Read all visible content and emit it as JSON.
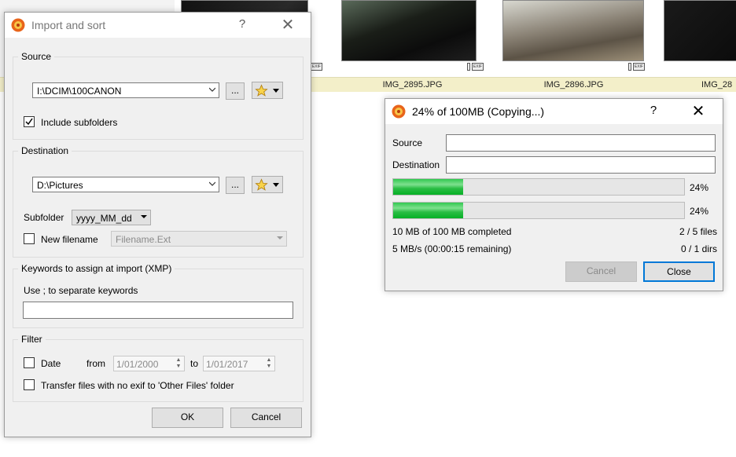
{
  "thumbnails": [
    {
      "caption": ""
    },
    {
      "caption": "IMG_2895.JPG"
    },
    {
      "caption": "IMG_2896.JPG"
    },
    {
      "caption": "IMG_28"
    }
  ],
  "exif_badge": "EXIF",
  "import_dialog": {
    "title": "Import and sort",
    "help": "?",
    "close": "✕",
    "source": {
      "label": "Source",
      "path": "I:\\DCIM\\100CANON",
      "browse": "...",
      "include_subfolders": "Include subfolders",
      "include_subfolders_checked": true
    },
    "destination": {
      "label": "Destination",
      "path": "D:\\Pictures",
      "browse": "...",
      "subfolder_label": "Subfolder",
      "subfolder_value": "yyyy_MM_dd",
      "new_filename_label": "New filename",
      "new_filename_checked": false,
      "filename_pattern": "Filename.Ext"
    },
    "keywords": {
      "label": "Keywords to assign at import (XMP)",
      "hint": "Use ; to separate keywords",
      "value": ""
    },
    "filter": {
      "label": "Filter",
      "date_label": "Date",
      "date_checked": false,
      "from_label": "from",
      "from_value": "1/01/2000",
      "to_label": "to",
      "to_value": "1/01/2017",
      "no_exif_label": "Transfer files with no exif to 'Other Files' folder",
      "no_exif_checked": false
    },
    "ok": "OK",
    "cancel": "Cancel"
  },
  "progress_dialog": {
    "title": "24% of 100MB (Copying...)",
    "help": "?",
    "close": "✕",
    "source_label": "Source",
    "source_value": "",
    "destination_label": "Destination",
    "destination_value": "",
    "bar1_percent_text": "24%",
    "bar1_fraction": 0.24,
    "bar2_percent_text": "24%",
    "bar2_fraction": 0.24,
    "completed": "10 MB of 100 MB completed",
    "files": "2 / 5 files",
    "speed": "5 MB/s (00:00:15 remaining)",
    "dirs": "0 / 1 dirs",
    "cancel": "Cancel",
    "close_button": "Close"
  },
  "colors": {
    "progress_green": "#06b025",
    "caption_bg": "#f3efc9",
    "default_button_border": "#0078d7"
  }
}
